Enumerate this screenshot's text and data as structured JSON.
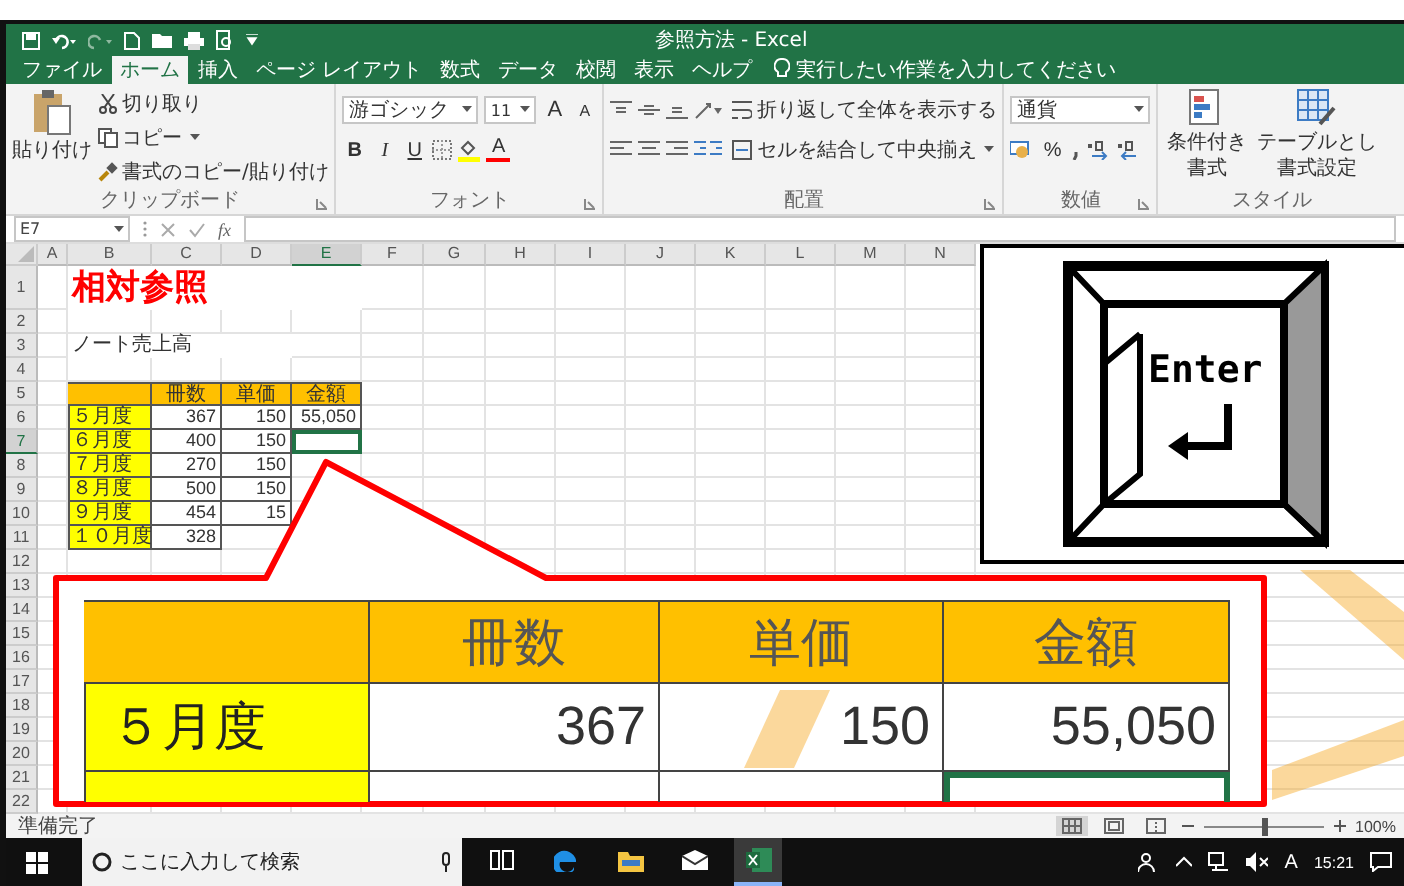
{
  "window": {
    "title": "参照方法 - Excel"
  },
  "ribbon_tabs": [
    {
      "label": "ファイル",
      "selected": false
    },
    {
      "label": "ホーム",
      "selected": true
    },
    {
      "label": "挿入",
      "selected": false
    },
    {
      "label": "ページ レイアウト",
      "selected": false
    },
    {
      "label": "数式",
      "selected": false
    },
    {
      "label": "データ",
      "selected": false
    },
    {
      "label": "校閲",
      "selected": false
    },
    {
      "label": "表示",
      "selected": false
    },
    {
      "label": "ヘルプ",
      "selected": false
    }
  ],
  "tell_me": {
    "placeholder": "実行したい作業を入力してください"
  },
  "clipboard": {
    "paste": "貼り付け",
    "cut": "切り取り",
    "copy": "コピー",
    "format_painter": "書式のコピー/貼り付け",
    "label": "クリップボード"
  },
  "font": {
    "name": "游ゴシック",
    "size": "11",
    "grow": "A",
    "shrink": "A",
    "bold": "B",
    "italic": "I",
    "underline": "U",
    "font_color": "A",
    "label": "フォント"
  },
  "alignment": {
    "wrap_text": "折り返して全体を表示する",
    "merge_center": "セルを結合して中央揃え",
    "label": "配置"
  },
  "number": {
    "format": "通貨",
    "percent": "%",
    "label": "数値"
  },
  "styles": {
    "conditional_formatting": [
      "条件付き",
      "書式"
    ],
    "format_as_table": [
      "テーブルとし",
      "書式設定"
    ],
    "label": "スタイル"
  },
  "formula_bar": {
    "name_box": "E7",
    "function": "fx"
  },
  "sheet": {
    "columns": [
      "A",
      "B",
      "C",
      "D",
      "E",
      "F",
      "G",
      "H",
      "I",
      "J",
      "K",
      "L",
      "M",
      "N"
    ],
    "rows": [
      "1",
      "2",
      "3",
      "4",
      "5",
      "6",
      "7",
      "8",
      "9",
      "10",
      "11",
      "12",
      "13",
      "14",
      "15",
      "16",
      "17",
      "18",
      "19",
      "20",
      "21",
      "22"
    ],
    "title": "相対参照",
    "note": "ノート売上高",
    "table": {
      "header": [
        "冊数",
        "単価",
        "金額"
      ],
      "rows": [
        {
          "label": "５月度",
          "cells": [
            {
              "text": "367",
              "selected": false
            },
            {
              "text": "150",
              "selected": false
            },
            {
              "text": "55,050",
              "selected": false
            }
          ]
        },
        {
          "label": "６月度",
          "cells": [
            {
              "text": "400",
              "selected": false
            },
            {
              "text": "150",
              "selected": false
            },
            {
              "selected": true
            }
          ]
        },
        {
          "label": "７月度",
          "cells": [
            {
              "text": "270",
              "selected": false
            },
            {
              "text": "150",
              "selected": false
            }
          ]
        },
        {
          "label": "８月度",
          "cells": [
            {
              "text": "500",
              "selected": false
            },
            {
              "text": "150",
              "selected": false
            }
          ]
        },
        {
          "label": "９月度",
          "cells": [
            {
              "text": "454",
              "selected": false
            },
            {
              "text": "15",
              "selected": false
            }
          ]
        },
        {
          "label": "１０月度",
          "cells": [
            {
              "text": "328",
              "selected": false
            }
          ]
        }
      ]
    }
  },
  "callout": {
    "header": [
      "冊数",
      "単価",
      "金額"
    ],
    "rows": [
      {
        "label": "５月度",
        "cells": [
          {
            "text": "367",
            "selected": false
          },
          {
            "text": "150",
            "selected": false
          },
          {
            "text": "55,050",
            "selected": false
          }
        ]
      },
      {
        "cells": [
          {
            "selected": false
          },
          {
            "selected": false
          },
          {
            "selected": true
          }
        ]
      }
    ]
  },
  "enter_key": {
    "label": "Enter"
  },
  "status_bar": {
    "text": "準備完了",
    "views": [
      {
        "kind": "normal",
        "selected": true
      },
      {
        "kind": "page_layout",
        "selected": false
      },
      {
        "kind": "page_break",
        "selected": false
      }
    ],
    "zoom": {
      "level": 0.5,
      "reading": "100%"
    }
  },
  "taskbar": {
    "search_placeholder": "ここに入力して検索",
    "apps": [
      {
        "kind": "task_view",
        "active": false
      },
      {
        "kind": "edge",
        "active": false
      },
      {
        "kind": "explorer",
        "active": false
      },
      {
        "kind": "mail",
        "active": false
      },
      {
        "kind": "excel",
        "active": true
      }
    ],
    "ime": "A",
    "time": "15:21"
  }
}
